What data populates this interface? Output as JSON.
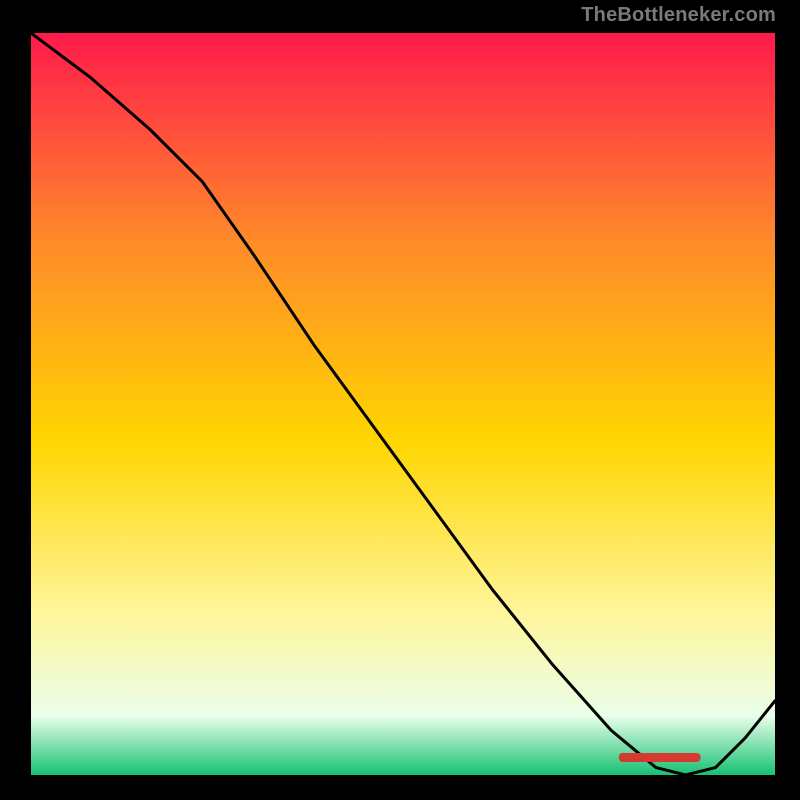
{
  "attribution": "TheBottleneker.com",
  "chart_data": {
    "type": "line",
    "title": "",
    "xlabel": "",
    "ylabel": "",
    "xlim": [
      0,
      100
    ],
    "ylim": [
      0,
      100
    ],
    "grid": false,
    "legend": false,
    "background_gradient": {
      "top": "#ff1a4b",
      "upper_mid": "#ff8a2a",
      "mid": "#ffd600",
      "lower_mid": "#fff59a",
      "lower": "#eaffea",
      "bottom": "#16c172"
    },
    "bottom_marker": {
      "label_color": "#d43a2f",
      "approx_x_range": [
        79,
        90
      ]
    },
    "series": [
      {
        "name": "curve",
        "color": "#000000",
        "x": [
          0,
          8,
          16,
          23,
          30,
          38,
          46,
          54,
          62,
          70,
          78,
          84,
          88,
          92,
          96,
          100
        ],
        "y": [
          100,
          94,
          87,
          80,
          70,
          58,
          47,
          36,
          25,
          15,
          6,
          1,
          0,
          1,
          5,
          10
        ]
      }
    ]
  }
}
